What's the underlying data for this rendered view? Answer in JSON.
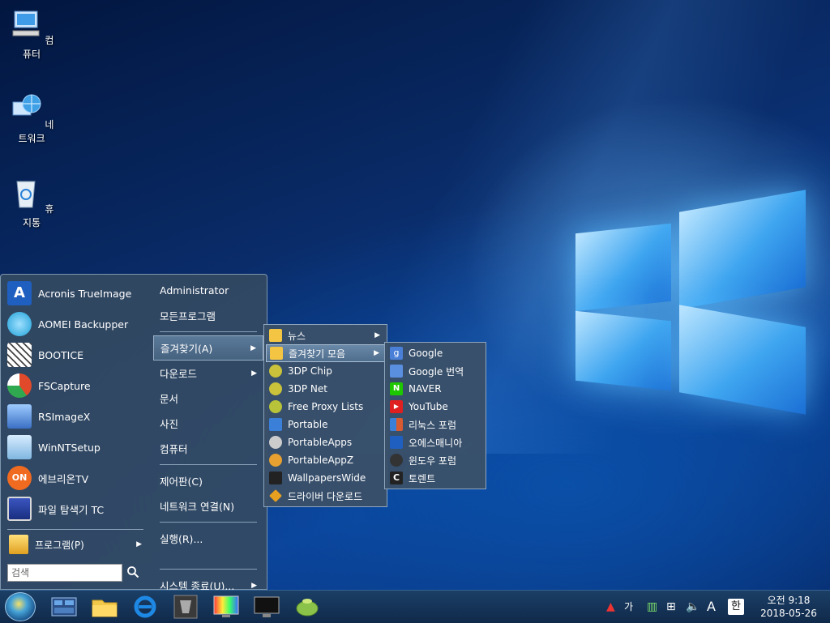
{
  "desktop": {
    "icons": [
      {
        "label": "컴퓨터",
        "icon": "computer-icon"
      },
      {
        "label": "네트워크",
        "icon": "network-icon"
      },
      {
        "label": "휴지통",
        "icon": "recycle-bin-icon"
      }
    ]
  },
  "start_menu": {
    "pinned_apps": [
      {
        "label": "Acronis TrueImage",
        "icon": "acronis-icon",
        "color": "#1f5fbf"
      },
      {
        "label": "AOMEI Backupper",
        "icon": "aomei-icon",
        "color": "#1ea0d8"
      },
      {
        "label": "BOOTICE",
        "icon": "bootice-icon",
        "color": "#dddddd"
      },
      {
        "label": "FSCapture",
        "icon": "fscapture-icon",
        "color": "#e04a2a"
      },
      {
        "label": "RSImageX",
        "icon": "rsimagex-icon",
        "color": "#3a6fc4"
      },
      {
        "label": "WinNTSetup",
        "icon": "winntsetup-icon",
        "color": "#7fb6e0"
      },
      {
        "label": "에브리온TV",
        "icon": "everyontv-icon",
        "color": "#f06a20"
      },
      {
        "label": "파일 탐색기 TC",
        "icon": "total-commander-icon",
        "color": "#2a3f9a"
      }
    ],
    "programs_label": "프로그램(P)",
    "search_placeholder": "검색",
    "right_items": [
      {
        "label": "Administrator",
        "has_submenu": false
      },
      {
        "label": "모든프로그램",
        "has_submenu": false
      },
      {
        "label": "즐겨찾기(A)",
        "has_submenu": true
      },
      {
        "label": "다운로드",
        "has_submenu": true
      },
      {
        "label": "문서",
        "has_submenu": false
      },
      {
        "label": "사진",
        "has_submenu": false
      },
      {
        "label": "컴퓨터",
        "has_submenu": false
      },
      {
        "label": "제어판(C)",
        "has_submenu": false
      },
      {
        "label": "네트워크 연결(N)",
        "has_submenu": false
      },
      {
        "label": "실행(R)...",
        "has_submenu": false
      },
      {
        "label": "시스템 종료(U)...",
        "has_submenu": true
      }
    ]
  },
  "favorites_menu": {
    "items": [
      {
        "label": "뉴스",
        "icon": "folder-icon",
        "color": "#f4c542",
        "has_submenu": true
      },
      {
        "label": "즐겨찾기 모음",
        "icon": "folder-icon",
        "color": "#f4c542",
        "has_submenu": true
      },
      {
        "label": "3DP Chip",
        "icon": "3dp-chip-icon",
        "color": "#c9c23a"
      },
      {
        "label": "3DP Net",
        "icon": "3dp-net-icon",
        "color": "#c9c23a"
      },
      {
        "label": "Free Proxy Lists",
        "icon": "proxy-icon",
        "color": "#b8c33a"
      },
      {
        "label": "Portable",
        "icon": "portable-icon",
        "color": "#3a7fd8"
      },
      {
        "label": "PortableApps",
        "icon": "portableapps-icon",
        "color": "#cccccc"
      },
      {
        "label": "PortableAppZ",
        "icon": "portableappz-icon",
        "color": "#e8a030"
      },
      {
        "label": "WallpapersWide",
        "icon": "wallpaperswide-icon",
        "color": "#222222"
      },
      {
        "label": "드라이버 다운로드",
        "icon": "driver-download-icon",
        "color": "#e8a020"
      }
    ]
  },
  "favorites_bar_menu": {
    "items": [
      {
        "label": "Google",
        "icon": "google-icon",
        "color": "#4a7fd8"
      },
      {
        "label": "Google 번역",
        "icon": "google-translate-icon",
        "color": "#5a8fe0"
      },
      {
        "label": "NAVER",
        "icon": "naver-icon",
        "color": "#1ec800"
      },
      {
        "label": "YouTube",
        "icon": "youtube-icon",
        "color": "#e02020"
      },
      {
        "label": "리눅스 포럼",
        "icon": "linux-forum-icon",
        "color": "#d85a30"
      },
      {
        "label": "오에스매니아",
        "icon": "osmania-icon",
        "color": "#1f5fbf"
      },
      {
        "label": "윈도우 포럼",
        "icon": "windows-forum-icon",
        "color": "#333333"
      },
      {
        "label": "토렌트",
        "icon": "torrent-icon",
        "color": "#222222"
      }
    ]
  },
  "taskbar": {
    "pinned": [
      {
        "icon": "task-view-icon",
        "color": "#3a5f9a"
      },
      {
        "icon": "file-explorer-icon",
        "color": "#f2c84b"
      },
      {
        "icon": "internet-explorer-icon",
        "color": "#1e88e5"
      },
      {
        "icon": "transformers-app-icon",
        "color": "#555555"
      },
      {
        "icon": "color-monitor-icon",
        "color": "#ff4aa0"
      },
      {
        "icon": "display-icon",
        "color": "#222222"
      },
      {
        "icon": "lime-app-icon",
        "color": "#8bc34a"
      }
    ],
    "tray": {
      "ime_mode": "A",
      "hangul": "한",
      "ime_label": "가",
      "time": "오전 9:18",
      "date": "2018-05-26"
    }
  }
}
